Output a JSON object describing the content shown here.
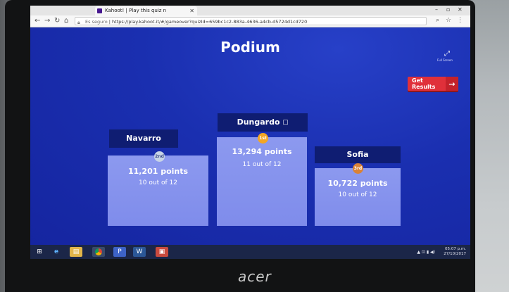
{
  "browser": {
    "tab_title": "Kahoot! | Play this quiz n",
    "url_secure_label": "Es seguro",
    "url": "https://play.kahoot.it/#/gameover?quizId=659bc1c2-883a-4636-a4cb-d5724d1cd720"
  },
  "game": {
    "title": "Podium",
    "fullscreen_label": "Full Screen",
    "get_results_label": "Get Results",
    "podium": [
      {
        "place": "first",
        "name": "Dungardo",
        "points": "13,294 points",
        "correct": "11 out of 12",
        "medal_text": "1st",
        "medal_color": "#f3a623"
      },
      {
        "place": "second",
        "name": "Navarro",
        "points": "11,201 points",
        "correct": "10 out of 12",
        "medal_text": "2nd",
        "medal_color": "#c8d4e6"
      },
      {
        "place": "third",
        "name": "Sofia",
        "points": "10,722 points",
        "correct": "10 out of 12",
        "medal_text": "3rd",
        "medal_color": "#d98236"
      }
    ]
  },
  "taskbar": {
    "time": "05:07 p.m.",
    "date": "27/10/2017",
    "apps": [
      "windows-start",
      "internet-explorer",
      "file-explorer",
      "chrome",
      "powerpoint",
      "word",
      "pdf-reader"
    ]
  },
  "laptop": {
    "brand": "acer"
  },
  "colors": {
    "accent": "#e0303a",
    "background": "#1c2fa6",
    "podium": "#7f8ceb",
    "name_tag": "#0f1d72"
  }
}
